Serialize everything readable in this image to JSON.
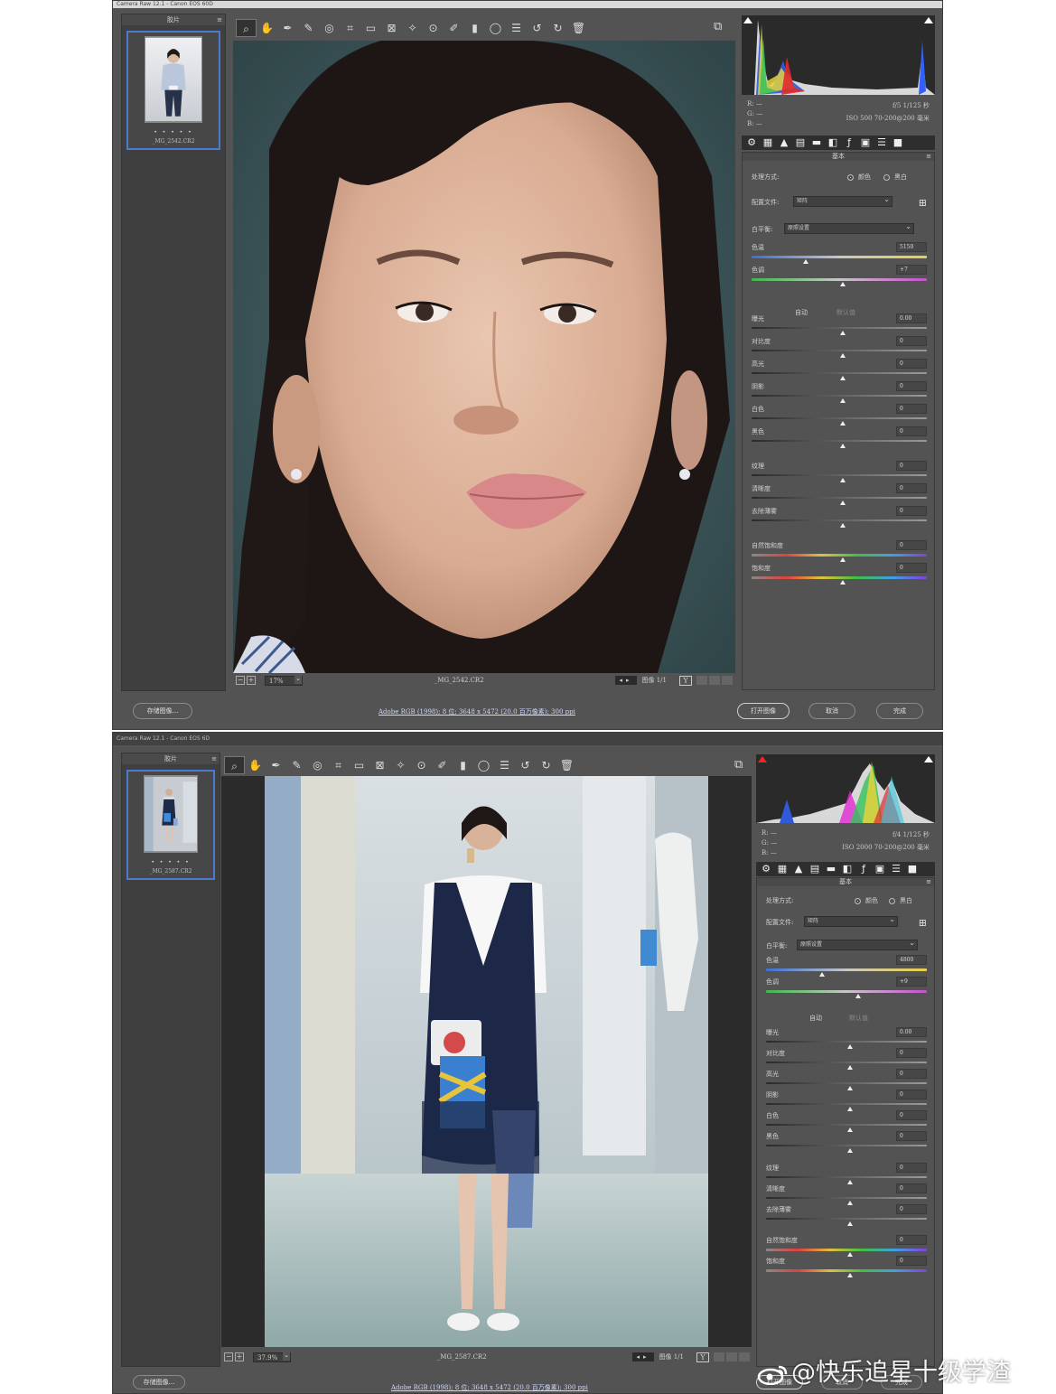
{
  "windows": [
    {
      "title": "Camera Raw 12.1 - Canon EOS 60D",
      "filmstrip": {
        "title": "胶片",
        "thumb_stars": "• • • • •",
        "thumb_name": "_MG_2542.CR2"
      },
      "preview": {
        "zoom": "17%",
        "filename": "_MG_2542.CR2",
        "image_count": "图像 1/1",
        "y_label": "Y"
      },
      "meta": {
        "r": "R:",
        "g": "G:",
        "b": "B:",
        "dash": "—",
        "line1": "f/5   1/125 秒",
        "line2": "ISO 500   70-200@200 毫米"
      },
      "panel": {
        "title": "基本",
        "treatment_label": "处理方式:",
        "color": "颜色",
        "bw": "黑白",
        "profile_label": "配置文件:",
        "profile_value": "矩阵",
        "wb_label": "白平衡:",
        "wb_value": "原照设置",
        "auto": "自动",
        "default": "默认值",
        "sliders": [
          {
            "label": "色温",
            "value": "5150"
          },
          {
            "label": "色调",
            "value": "+7"
          },
          {
            "label": "曝光",
            "value": "0.00"
          },
          {
            "label": "对比度",
            "value": "0"
          },
          {
            "label": "高光",
            "value": "0"
          },
          {
            "label": "阴影",
            "value": "0"
          },
          {
            "label": "白色",
            "value": "0"
          },
          {
            "label": "黑色",
            "value": "0"
          },
          {
            "label": "纹理",
            "value": "0"
          },
          {
            "label": "清晰度",
            "value": "0"
          },
          {
            "label": "去除薄雾",
            "value": "0"
          },
          {
            "label": "自然饱和度",
            "value": "0"
          },
          {
            "label": "饱和度",
            "value": "0"
          }
        ]
      },
      "bottom": {
        "save": "存储图像...",
        "workflow": "Adobe RGB (1998); 8 位; 3648 x 5472 (20.0 百万像素); 300 ppi",
        "open": "打开图像",
        "cancel": "取消",
        "done": "完成"
      }
    },
    {
      "title": "Camera Raw 12.1 - Canon EOS 6D",
      "filmstrip": {
        "title": "胶片",
        "thumb_stars": "• • • • •",
        "thumb_name": "_MG_2587.CR2"
      },
      "preview": {
        "zoom": "37.9%",
        "filename": "_MG_2587.CR2",
        "image_count": "图像 1/1",
        "y_label": "Y"
      },
      "meta": {
        "r": "R:",
        "g": "G:",
        "b": "B:",
        "dash": "—",
        "line1": "f/4   1/125 秒",
        "line2": "ISO 2000   70-200@200 毫米"
      },
      "panel": {
        "title": "基本",
        "treatment_label": "处理方式:",
        "color": "颜色",
        "bw": "黑白",
        "profile_label": "配置文件:",
        "profile_value": "矩阵",
        "wb_label": "白平衡:",
        "wb_value": "原照设置",
        "auto": "自动",
        "default": "默认值",
        "sliders": [
          {
            "label": "色温",
            "value": "4800"
          },
          {
            "label": "色调",
            "value": "+9"
          },
          {
            "label": "曝光",
            "value": "0.00"
          },
          {
            "label": "对比度",
            "value": "0"
          },
          {
            "label": "高光",
            "value": "0"
          },
          {
            "label": "阴影",
            "value": "0"
          },
          {
            "label": "白色",
            "value": "0"
          },
          {
            "label": "黑色",
            "value": "0"
          },
          {
            "label": "纹理",
            "value": "0"
          },
          {
            "label": "清晰度",
            "value": "0"
          },
          {
            "label": "去除薄雾",
            "value": "0"
          },
          {
            "label": "自然饱和度",
            "value": "0"
          },
          {
            "label": "饱和度",
            "value": "0"
          }
        ]
      },
      "bottom": {
        "save": "存储图像...",
        "workflow": "Adobe RGB (1998); 8 位; 3648 x 5472 (20.0 百万像素); 300 ppi",
        "open": "打开图像",
        "cancel": "取消",
        "done": "完成"
      }
    }
  ],
  "watermark": "@快乐追星十级学渣",
  "colors": {
    "panel_bg": "#535353",
    "selection_border": "#4b7bd0",
    "dark_bg": "#2d2d2d"
  },
  "icons": [
    "zoom-icon",
    "hand-icon",
    "white-balance-icon",
    "color-sampler-icon",
    "target-adjust-icon",
    "crop-icon",
    "straighten-icon",
    "transform-icon",
    "spot-removal-icon",
    "red-eye-icon",
    "adjustment-brush-icon",
    "graduated-filter-icon",
    "radial-filter-icon",
    "preferences-icon",
    "rotate-left-icon",
    "rotate-right-icon",
    "trash-icon"
  ]
}
